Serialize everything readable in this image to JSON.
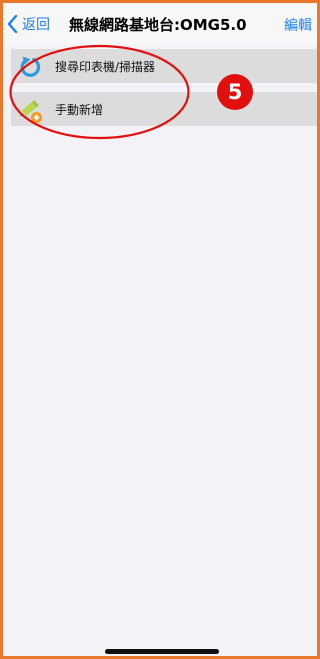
{
  "navbar": {
    "back_label": "返回",
    "title": "無線網路基地台:OMG5.0",
    "edit_label": "編輯"
  },
  "list": {
    "items": [
      {
        "label": "搜尋印表機/掃描器",
        "icon": "refresh-icon"
      },
      {
        "label": "手動新增",
        "icon": "pencil-add-icon"
      }
    ]
  },
  "annotation": {
    "step_number": "5",
    "color": "#e20f0f"
  },
  "colors": {
    "accent": "#1f7ef2",
    "frame": "#e8792c"
  }
}
